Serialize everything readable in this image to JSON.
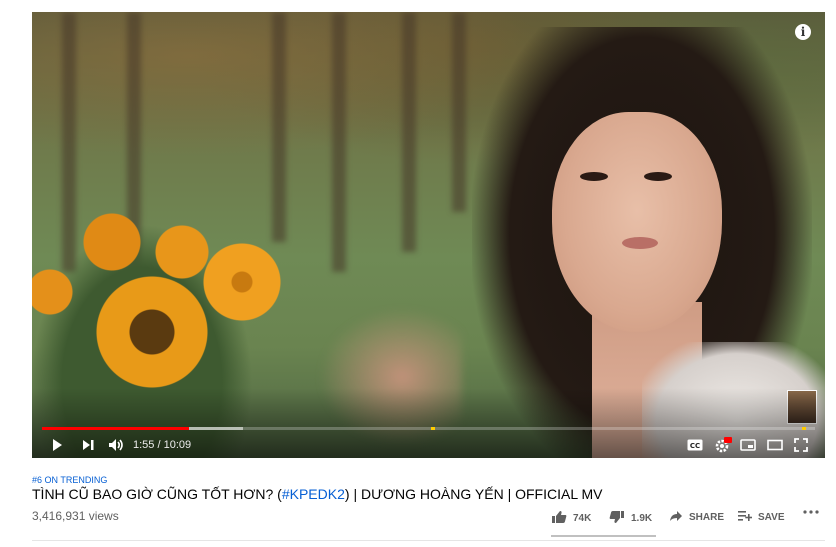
{
  "player": {
    "time_display": "1:55 / 10:09",
    "progress": {
      "played_fraction": 0.19,
      "buffered_fraction": 0.26
    },
    "icons": {
      "play": "play-icon",
      "next": "next-icon",
      "volume": "volume-icon",
      "captions": "captions-icon",
      "settings": "settings-icon",
      "miniplayer": "miniplayer-icon",
      "theater": "theater-icon",
      "fullscreen": "fullscreen-icon",
      "info": "info-icon"
    },
    "settings_badge": "HD"
  },
  "video": {
    "trending": "#6 ON TRENDING",
    "title_start": "TÌNH CŨ BAO GIỜ CŨNG TỐT HƠN? (",
    "title_tag": "#KPEDK2",
    "title_end": ") | DƯƠNG HOÀNG YẾN | OFFICIAL MV",
    "views": "3,416,931 views"
  },
  "actions": {
    "like_count": "74K",
    "dislike_count": "1.9K",
    "share_label": "SHARE",
    "save_label": "SAVE",
    "more_icon": "more-icon"
  },
  "colors": {
    "brand_red": "#ff0000",
    "link_blue": "#065fd4",
    "text": "#030303",
    "muted": "#606060"
  }
}
